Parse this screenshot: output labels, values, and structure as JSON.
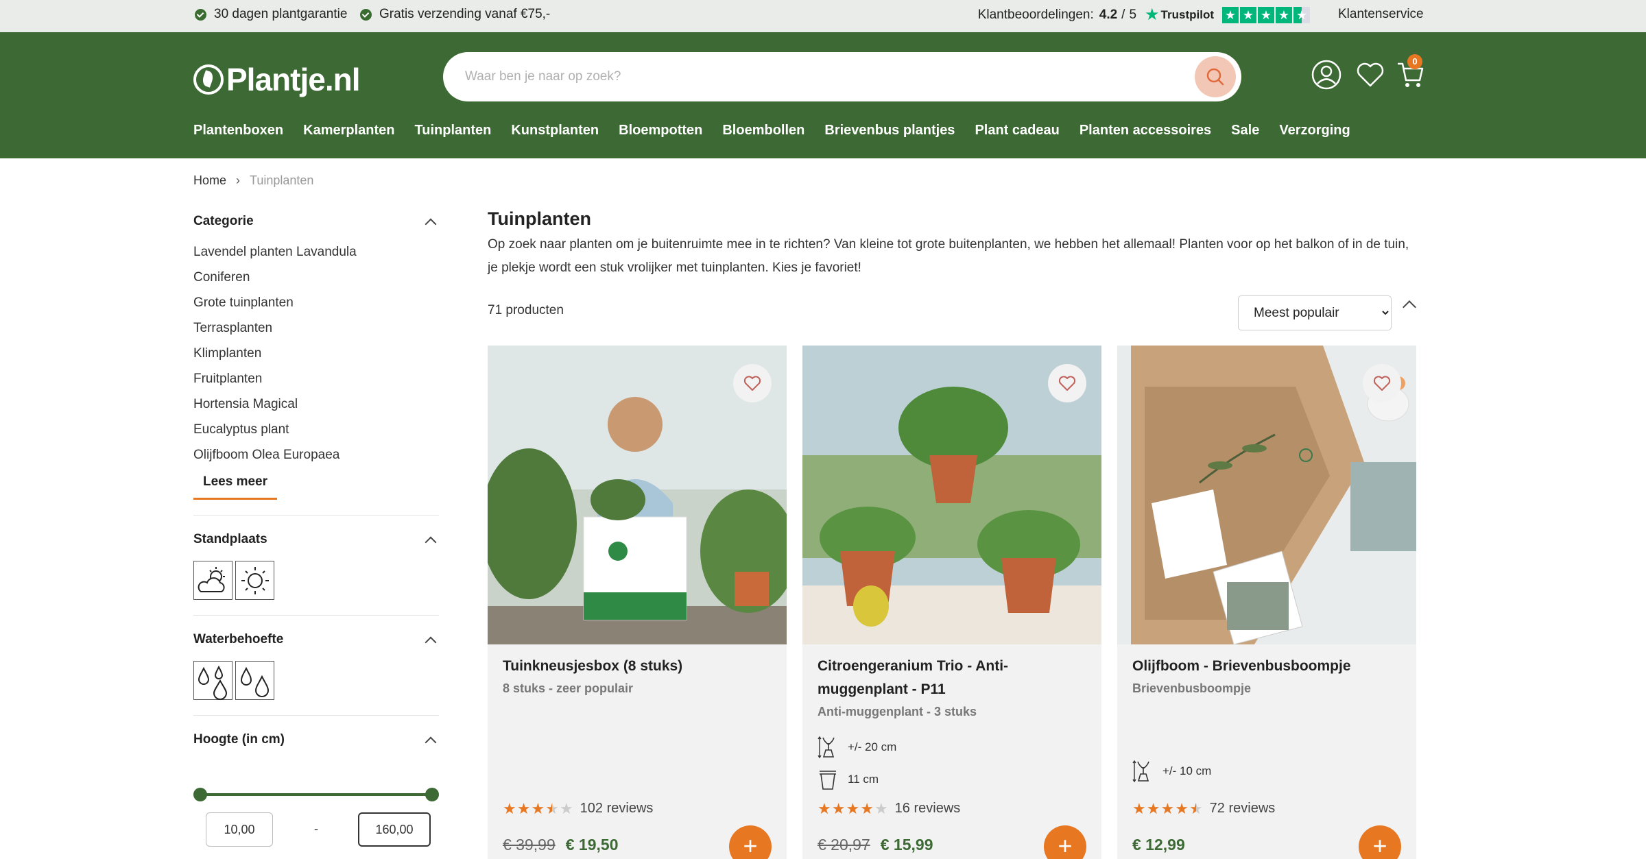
{
  "topbar": {
    "usps": [
      "30 dagen plantgarantie",
      "Gratis verzending vanaf €75,-"
    ],
    "reviews_label": "Klantbeoordelingen:",
    "reviews_score": "4.2",
    "reviews_sep": "/",
    "reviews_max": "5",
    "trustpilot": "Trustpilot",
    "trustpilot_stars": 4.5,
    "customer_service": "Klantenservice"
  },
  "header": {
    "logo": "Plantje.nl",
    "search_placeholder": "Waar ben je naar op zoek?",
    "cart_count": "0",
    "nav": [
      "Plantenboxen",
      "Kamerplanten",
      "Tuinplanten",
      "Kunstplanten",
      "Bloempotten",
      "Bloembollen",
      "Brievenbus plantjes",
      "Plant cadeau",
      "Planten accessoires",
      "Sale",
      "Verzorging"
    ]
  },
  "breadcrumb": {
    "home": "Home",
    "current": "Tuinplanten"
  },
  "sidebar": {
    "categorie_title": "Categorie",
    "categories": [
      "Lavendel planten Lavandula",
      "Coniferen",
      "Grote tuinplanten",
      "Terrasplanten",
      "Klimplanten",
      "Fruitplanten",
      "Hortensia Magical",
      "Eucalyptus plant",
      "Olijfboom Olea Europaea"
    ],
    "read_more": "Lees meer",
    "standplaats_title": "Standplaats",
    "standplaats_icons": [
      "partly-sunny-icon",
      "full-sun-icon"
    ],
    "water_title": "Waterbehoefte",
    "water_icons": [
      "water-drops-three-icon",
      "water-drops-two-icon"
    ],
    "height_title": "Hoogte (in cm)",
    "height_min": "10,00",
    "height_max": "160,00",
    "range_dash": "-"
  },
  "main": {
    "title": "Tuinplanten",
    "intro": "Op zoek naar planten om je buitenruimte mee in te richten? Van kleine tot grote buitenplanten, we hebben het allemaal! Planten voor op het balkon of in de tuin, je plekje wordt een stuk vrolijker met tuinplanten. Kies je favoriet!",
    "count": "71 producten",
    "sort_selected": "Meest populair"
  },
  "products": [
    {
      "title": "Tuinkneusjesbox (8 stuks)",
      "subtitle": "8 stuks - zeer populair",
      "specs": [],
      "rating": 3.5,
      "reviews": "102 reviews",
      "old_price": "€ 39,99",
      "price": "€ 19,50",
      "add": "+"
    },
    {
      "title": "Citroengeranium Trio - Anti-muggenplant - P11",
      "subtitle": "Anti-muggenplant - 3 stuks",
      "specs": [
        "+/- 20 cm",
        "11 cm"
      ],
      "rating": 4,
      "reviews": "16 reviews",
      "old_price": "€ 20,97",
      "price": "€ 15,99",
      "add": "+"
    },
    {
      "title": "Olijfboom - Brievenbusboompje",
      "subtitle": "Brievenbusboompje",
      "specs": [
        "+/- 10 cm"
      ],
      "rating": 4.5,
      "reviews": "72 reviews",
      "old_price": "",
      "price": "€ 12,99",
      "add": "+"
    }
  ],
  "colors": {
    "brand_green": "#3d6a34",
    "accent_orange": "#e87722",
    "trustpilot_green": "#00b67a",
    "star_orange": "#e87722"
  }
}
